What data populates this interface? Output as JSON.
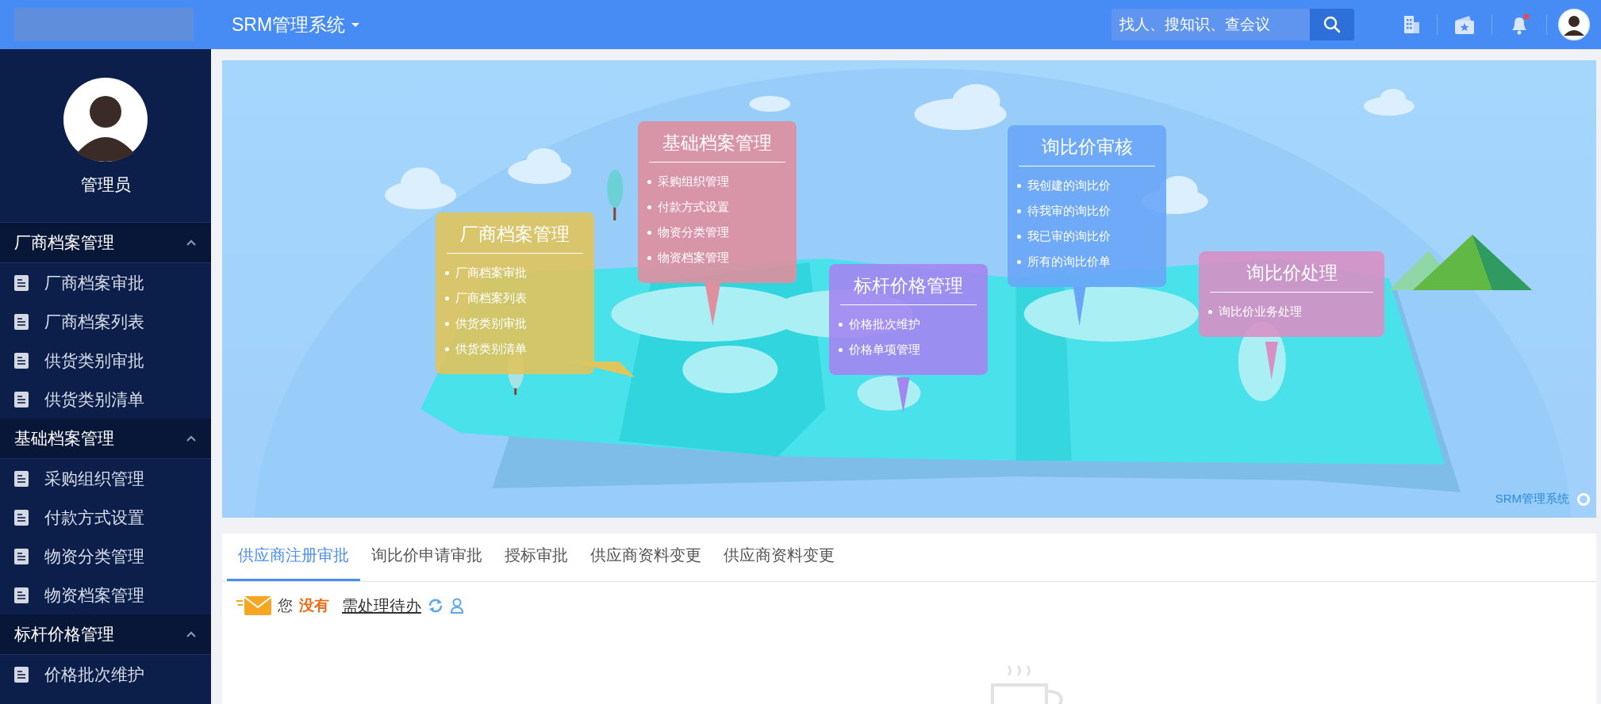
{
  "header": {
    "app_title": "SRM管理系统",
    "search": {
      "placeholder": "找人、搜知识、查会议"
    },
    "bell": {
      "unread": true
    }
  },
  "user": {
    "name": "管理员"
  },
  "sidebar": {
    "groups": [
      {
        "title": "厂商档案管理",
        "expanded": true,
        "items": [
          "厂商档案审批",
          "厂商档案列表",
          "供货类别审批",
          "供货类别清单"
        ]
      },
      {
        "title": "基础档案管理",
        "expanded": true,
        "items": [
          "采购组织管理",
          "付款方式设置",
          "物资分类管理",
          "物资档案管理"
        ]
      },
      {
        "title": "标杆价格管理",
        "expanded": true,
        "items": [
          "价格批次维护"
        ]
      }
    ]
  },
  "banner": {
    "cards": [
      {
        "title": "厂商档案管理",
        "color": "#e0c45c",
        "items": [
          "厂商档案审批",
          "厂商档案列表",
          "供货类别审批",
          "供货类别清单"
        ]
      },
      {
        "title": "基础档案管理",
        "color": "#e08f9e",
        "items": [
          "采购组织管理",
          "付款方式设置",
          "物资分类管理",
          "物资档案管理"
        ]
      },
      {
        "title": "标杆价格管理",
        "color": "#a386f2",
        "items": [
          "价格批次维护",
          "价格单项管理"
        ]
      },
      {
        "title": "询比价审核",
        "color": "#6aa6f8",
        "items": [
          "我创建的询比价",
          "待我审的询比价",
          "我已审的询比价",
          "所有的询比价单"
        ]
      },
      {
        "title": "询比价处理",
        "color": "#d890c4",
        "items": [
          "询比价业务处理"
        ]
      }
    ],
    "caption": "SRM管理系统"
  },
  "tabs": [
    {
      "label": "供应商注册审批",
      "selected": true
    },
    {
      "label": "询比价申请审批",
      "selected": false
    },
    {
      "label": "授标审批",
      "selected": false
    },
    {
      "label": "供应商资料变更",
      "selected": false
    },
    {
      "label": "供应商资料变更",
      "selected": false
    }
  ],
  "notice": {
    "prefix": "您",
    "count": "没有",
    "link": "需处理待办"
  }
}
